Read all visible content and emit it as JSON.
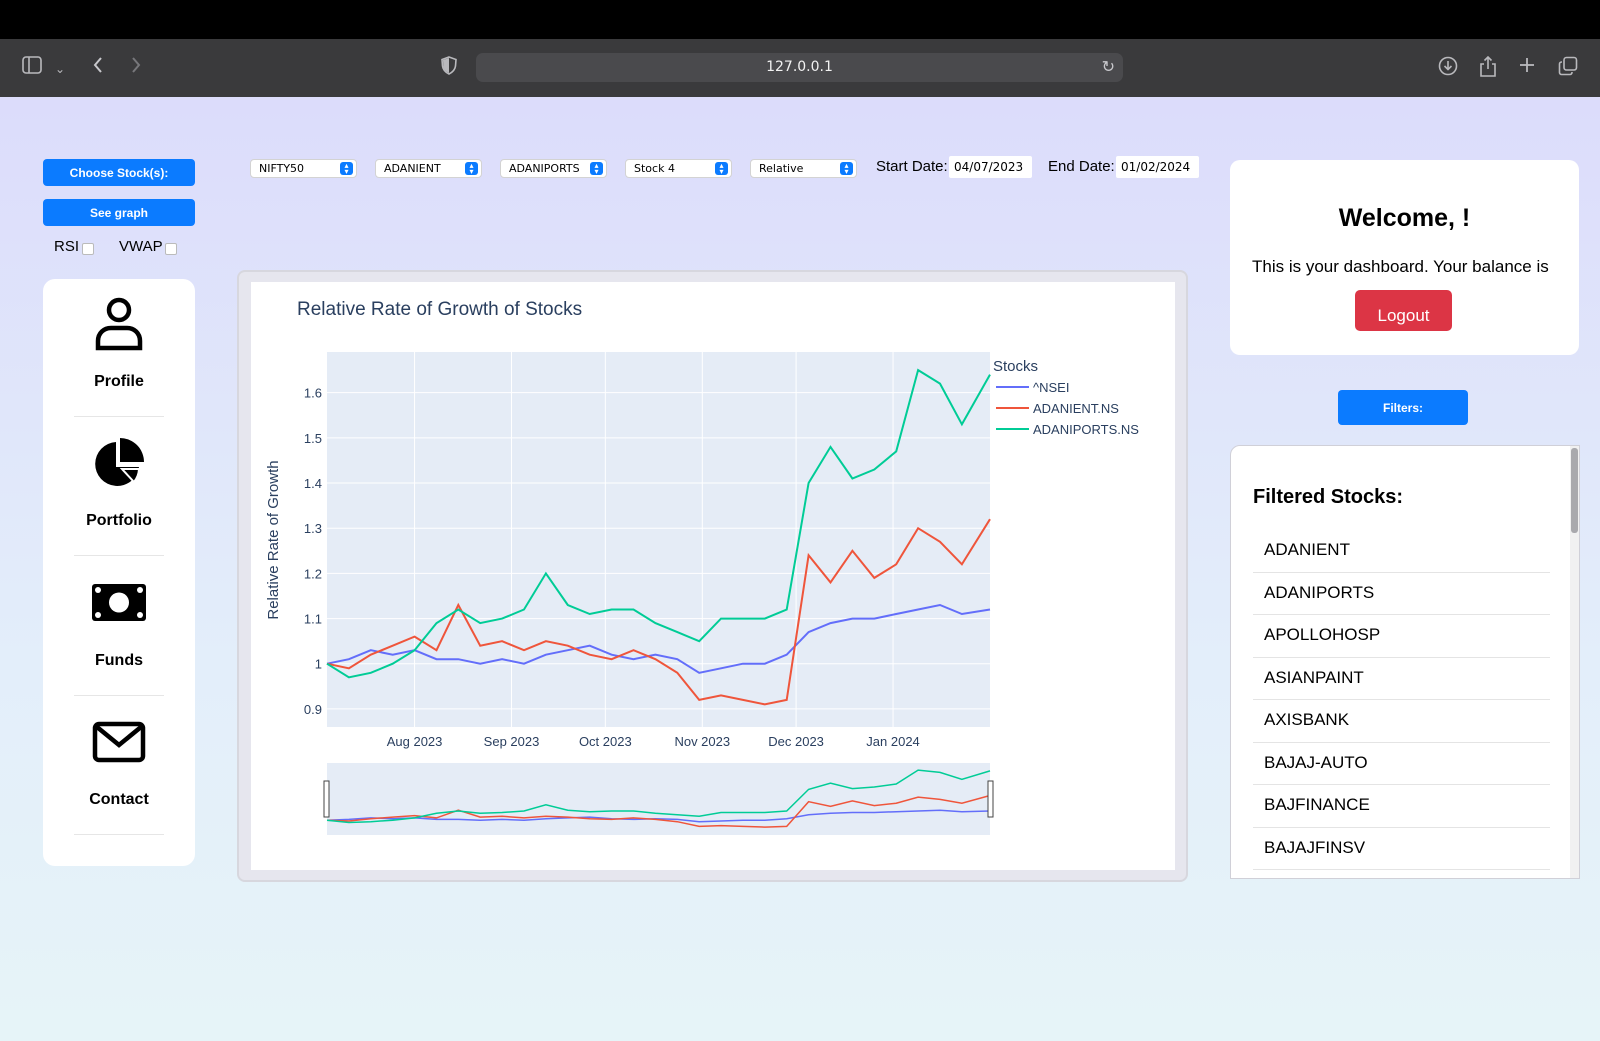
{
  "browser": {
    "url": "127.0.0.1"
  },
  "controls": {
    "choose_stocks_label": "Choose Stock(s):",
    "see_graph_label": "See graph",
    "rsi_label": "RSI",
    "vwap_label": "VWAP",
    "filters_label": "Filters:"
  },
  "selects": [
    {
      "value": "NIFTY50"
    },
    {
      "value": "ADANIENT"
    },
    {
      "value": "ADANIPORTS"
    },
    {
      "value": "Stock 4"
    },
    {
      "value": "Relative"
    }
  ],
  "dates": {
    "start_label": "Start Date:",
    "start_value": "04/07/2023",
    "end_label": "End Date:",
    "end_value": "01/02/2024"
  },
  "sidebar": {
    "items": [
      {
        "label": "Profile",
        "icon": "person-icon"
      },
      {
        "label": "Portfolio",
        "icon": "pie-chart-icon"
      },
      {
        "label": "Funds",
        "icon": "money-icon"
      },
      {
        "label": "Contact",
        "icon": "envelope-icon"
      }
    ]
  },
  "welcome": {
    "title": "Welcome, !",
    "text": "This is your dashboard. Your balance is",
    "logout_label": "Logout"
  },
  "filtered": {
    "title": "Filtered Stocks:",
    "stocks": [
      "ADANIENT",
      "ADANIPORTS",
      "APOLLOHOSP",
      "ASIANPAINT",
      "AXISBANK",
      "BAJAJ-AUTO",
      "BAJFINANCE",
      "BAJAJFINSV"
    ]
  },
  "colors": {
    "accent": "#0b7bff",
    "danger": "#dc3545",
    "nsei": "#636efa",
    "adanient": "#ef553b",
    "adaniports": "#00cc96"
  },
  "chart_data": {
    "type": "line",
    "title": "Relative Rate of Growth of Stocks",
    "xlabel": "",
    "ylabel": "Relative Rate of Growth",
    "legend_title": "Stocks",
    "legend_position": "top-right",
    "x_ticks": [
      "Aug 2023",
      "Sep 2023",
      "Oct 2023",
      "Nov 2023",
      "Dec 2023",
      "Jan 2024"
    ],
    "y_ticks": [
      "0.9",
      "1",
      "1.1",
      "1.2",
      "1.3",
      "1.4",
      "1.5",
      "1.6"
    ],
    "ylim": [
      0.86,
      1.69
    ],
    "xlim": [
      "2023-07-04",
      "2024-02-01"
    ],
    "grid": true,
    "range_slider": true,
    "series": [
      {
        "name": "^NSEI",
        "points": [
          [
            "2023-07-04",
            1.0
          ],
          [
            "2023-07-11",
            1.01
          ],
          [
            "2023-07-18",
            1.03
          ],
          [
            "2023-07-25",
            1.02
          ],
          [
            "2023-08-01",
            1.03
          ],
          [
            "2023-08-08",
            1.01
          ],
          [
            "2023-08-15",
            1.01
          ],
          [
            "2023-08-22",
            1.0
          ],
          [
            "2023-08-29",
            1.01
          ],
          [
            "2023-09-05",
            1.0
          ],
          [
            "2023-09-12",
            1.02
          ],
          [
            "2023-09-19",
            1.03
          ],
          [
            "2023-09-26",
            1.04
          ],
          [
            "2023-10-03",
            1.02
          ],
          [
            "2023-10-10",
            1.01
          ],
          [
            "2023-10-17",
            1.02
          ],
          [
            "2023-10-24",
            1.01
          ],
          [
            "2023-10-31",
            0.98
          ],
          [
            "2023-11-07",
            0.99
          ],
          [
            "2023-11-14",
            1.0
          ],
          [
            "2023-11-21",
            1.0
          ],
          [
            "2023-11-28",
            1.02
          ],
          [
            "2023-12-05",
            1.07
          ],
          [
            "2023-12-12",
            1.09
          ],
          [
            "2023-12-19",
            1.1
          ],
          [
            "2023-12-26",
            1.1
          ],
          [
            "2024-01-02",
            1.11
          ],
          [
            "2024-01-09",
            1.12
          ],
          [
            "2024-01-16",
            1.13
          ],
          [
            "2024-01-23",
            1.11
          ],
          [
            "2024-02-01",
            1.12
          ]
        ]
      },
      {
        "name": "ADANIENT.NS",
        "points": [
          [
            "2023-07-04",
            1.0
          ],
          [
            "2023-07-11",
            0.99
          ],
          [
            "2023-07-18",
            1.02
          ],
          [
            "2023-07-25",
            1.04
          ],
          [
            "2023-08-01",
            1.06
          ],
          [
            "2023-08-08",
            1.03
          ],
          [
            "2023-08-15",
            1.13
          ],
          [
            "2023-08-22",
            1.04
          ],
          [
            "2023-08-29",
            1.05
          ],
          [
            "2023-09-05",
            1.03
          ],
          [
            "2023-09-12",
            1.05
          ],
          [
            "2023-09-19",
            1.04
          ],
          [
            "2023-09-26",
            1.02
          ],
          [
            "2023-10-03",
            1.01
          ],
          [
            "2023-10-10",
            1.03
          ],
          [
            "2023-10-17",
            1.01
          ],
          [
            "2023-10-24",
            0.98
          ],
          [
            "2023-10-31",
            0.92
          ],
          [
            "2023-11-07",
            0.93
          ],
          [
            "2023-11-14",
            0.92
          ],
          [
            "2023-11-21",
            0.91
          ],
          [
            "2023-11-28",
            0.92
          ],
          [
            "2023-12-05",
            1.24
          ],
          [
            "2023-12-12",
            1.18
          ],
          [
            "2023-12-19",
            1.25
          ],
          [
            "2023-12-26",
            1.19
          ],
          [
            "2024-01-02",
            1.22
          ],
          [
            "2024-01-09",
            1.3
          ],
          [
            "2024-01-16",
            1.27
          ],
          [
            "2024-01-23",
            1.22
          ],
          [
            "2024-02-01",
            1.32
          ]
        ]
      },
      {
        "name": "ADANIPORTS.NS",
        "points": [
          [
            "2023-07-04",
            1.0
          ],
          [
            "2023-07-11",
            0.97
          ],
          [
            "2023-07-18",
            0.98
          ],
          [
            "2023-07-25",
            1.0
          ],
          [
            "2023-08-01",
            1.03
          ],
          [
            "2023-08-08",
            1.09
          ],
          [
            "2023-08-15",
            1.12
          ],
          [
            "2023-08-22",
            1.09
          ],
          [
            "2023-08-29",
            1.1
          ],
          [
            "2023-09-05",
            1.12
          ],
          [
            "2023-09-12",
            1.2
          ],
          [
            "2023-09-19",
            1.13
          ],
          [
            "2023-09-26",
            1.11
          ],
          [
            "2023-10-03",
            1.12
          ],
          [
            "2023-10-10",
            1.12
          ],
          [
            "2023-10-17",
            1.09
          ],
          [
            "2023-10-24",
            1.07
          ],
          [
            "2023-10-31",
            1.05
          ],
          [
            "2023-11-07",
            1.1
          ],
          [
            "2023-11-14",
            1.1
          ],
          [
            "2023-11-21",
            1.1
          ],
          [
            "2023-11-28",
            1.12
          ],
          [
            "2023-12-05",
            1.4
          ],
          [
            "2023-12-12",
            1.48
          ],
          [
            "2023-12-19",
            1.41
          ],
          [
            "2023-12-26",
            1.43
          ],
          [
            "2024-01-02",
            1.47
          ],
          [
            "2024-01-09",
            1.65
          ],
          [
            "2024-01-16",
            1.62
          ],
          [
            "2024-01-23",
            1.53
          ],
          [
            "2024-02-01",
            1.64
          ]
        ]
      }
    ]
  }
}
